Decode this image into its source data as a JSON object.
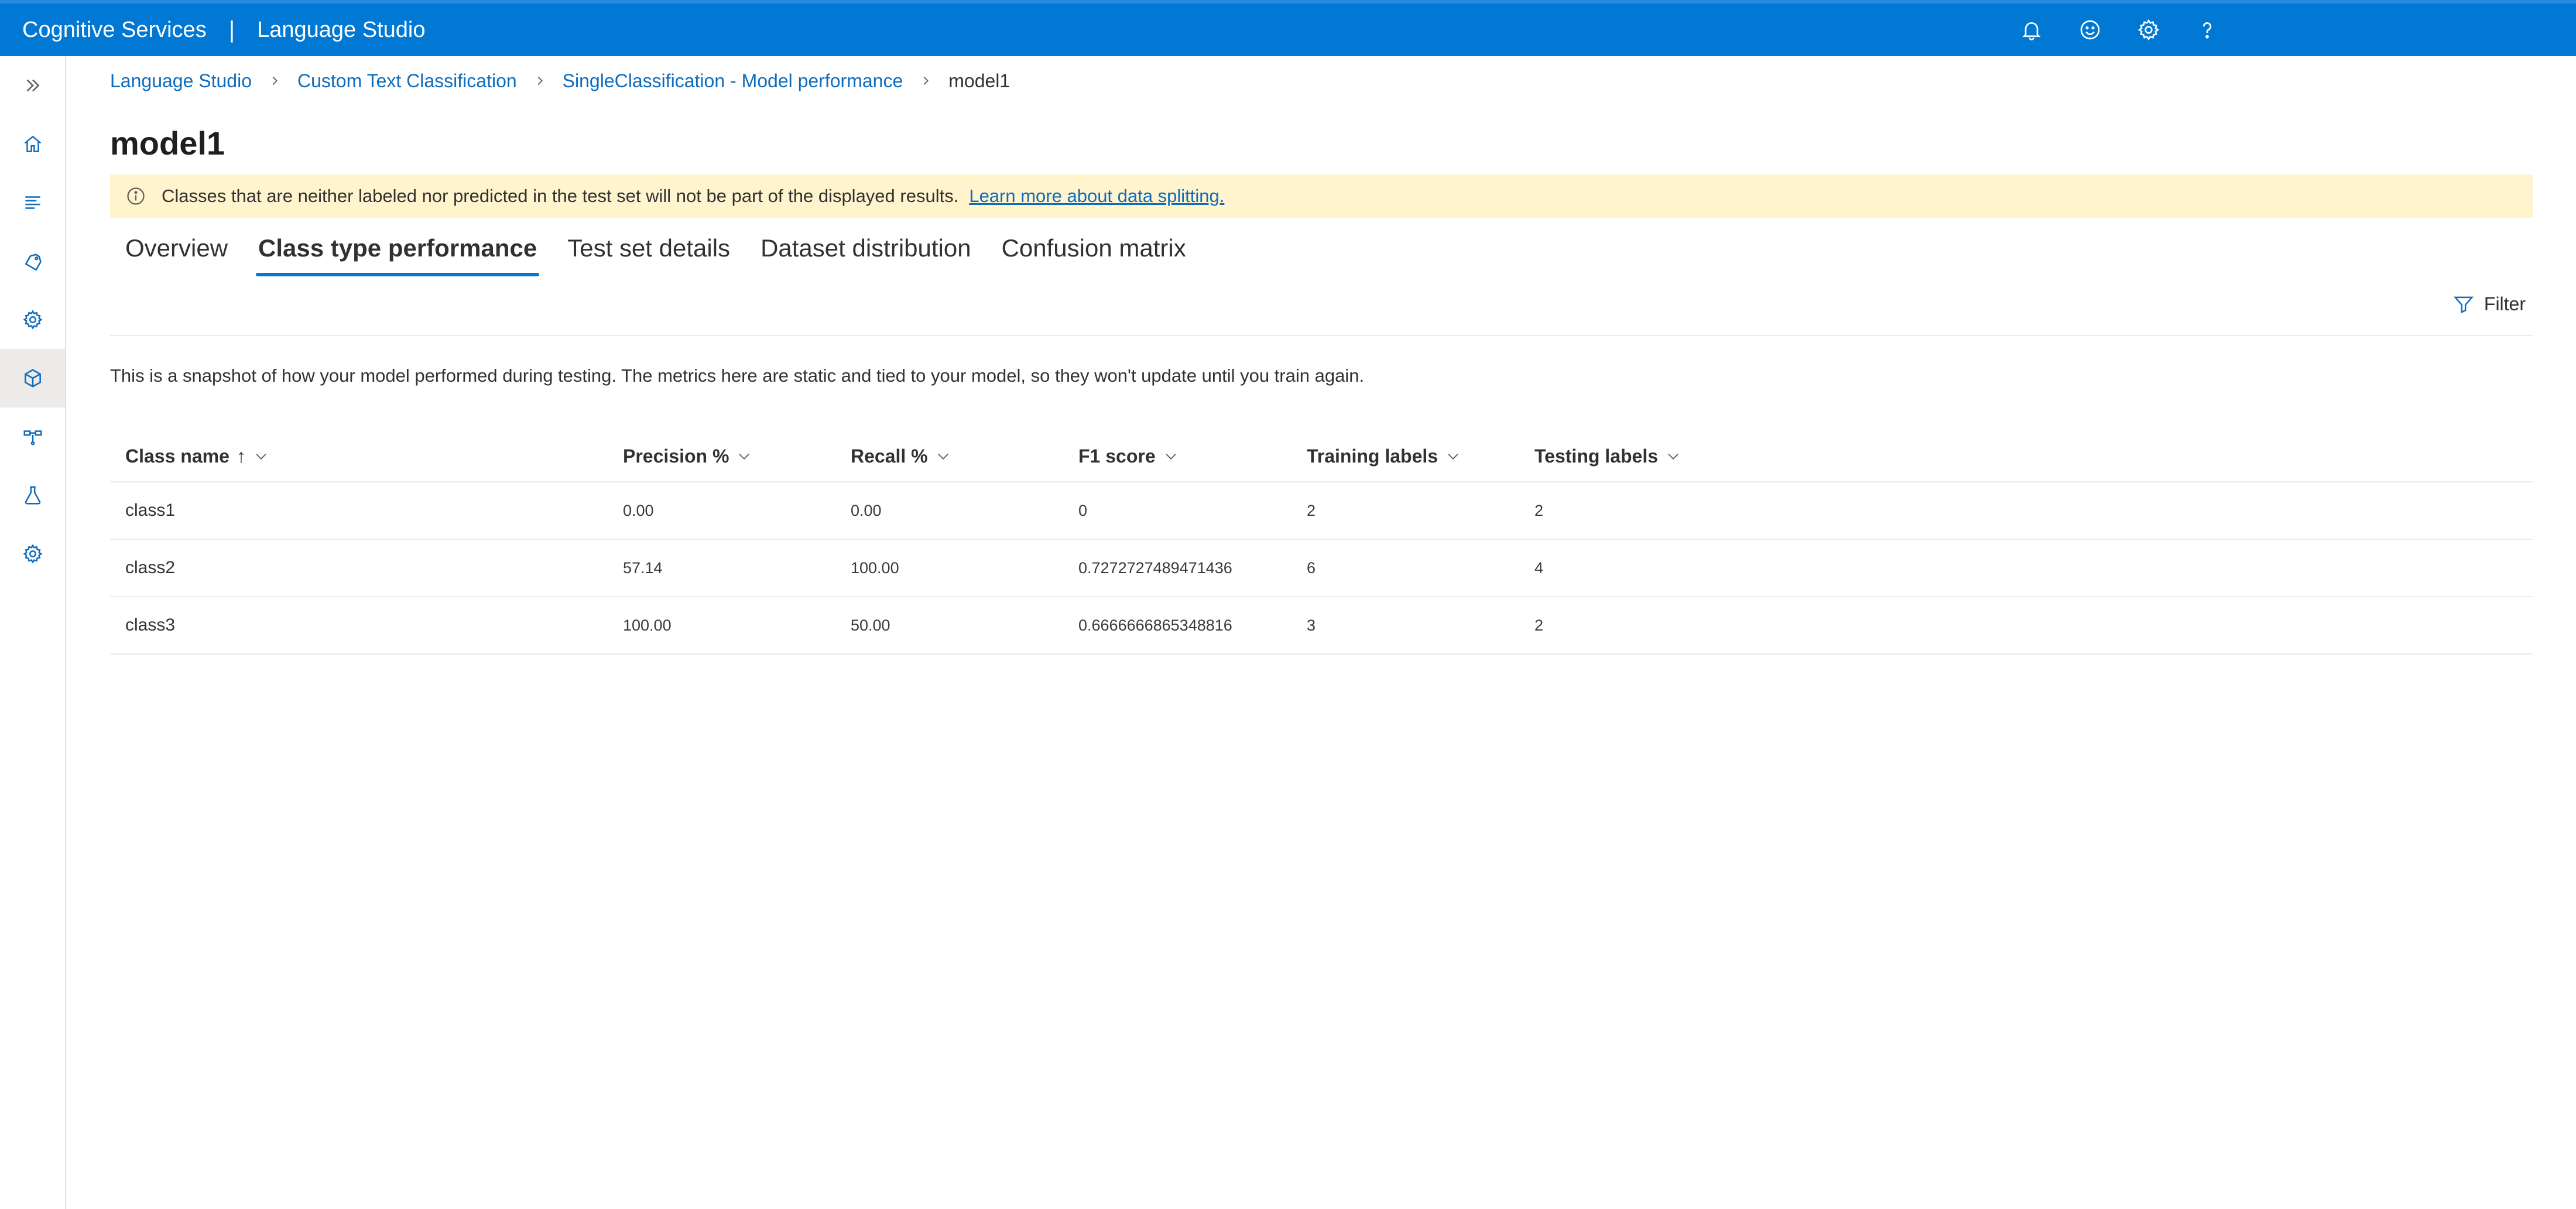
{
  "topbar": {
    "product": "Cognitive Services",
    "separator": "|",
    "app": "Language Studio",
    "icons": [
      "bell-icon",
      "smiley-icon",
      "gear-icon",
      "help-icon"
    ]
  },
  "leftnav": {
    "icons": [
      "expand-icon",
      "home-icon",
      "document-icon",
      "tag-icon",
      "model-gear-icon",
      "cube-icon",
      "deploy-icon",
      "flask-icon",
      "settings-icon"
    ],
    "active": "cube-icon"
  },
  "breadcrumb": {
    "items": [
      "Language Studio",
      "Custom Text Classification",
      "SingleClassification - Model performance",
      "model1"
    ]
  },
  "page": {
    "title": "model1"
  },
  "banner": {
    "text": "Classes that are neither labeled nor predicted in the test set will not be part of the displayed results.",
    "link": "Learn more about data splitting."
  },
  "tabs": {
    "items": [
      "Overview",
      "Class type performance",
      "Test set details",
      "Dataset distribution",
      "Confusion matrix"
    ],
    "active": "Class type performance"
  },
  "toolbar": {
    "filter_label": "Filter"
  },
  "snapshot_text": "This is a snapshot of how your model performed during testing. The metrics here are static and tied to your model, so they won't update until you train again.",
  "table": {
    "columns": [
      "Class name",
      "Precision %",
      "Recall %",
      "F1 score",
      "Training labels",
      "Testing labels"
    ],
    "sort_indicator": "↑",
    "rows": [
      [
        "class1",
        "0.00",
        "0.00",
        "0",
        "2",
        "2"
      ],
      [
        "class2",
        "57.14",
        "100.00",
        "0.7272727489471436",
        "6",
        "4"
      ],
      [
        "class3",
        "100.00",
        "50.00",
        "0.6666666865348816",
        "3",
        "2"
      ]
    ]
  },
  "colors": {
    "topbar": "#0078d4",
    "banner": "#fff4ce",
    "link": "#0f6cbd",
    "tab_underline": "#0078d4"
  }
}
